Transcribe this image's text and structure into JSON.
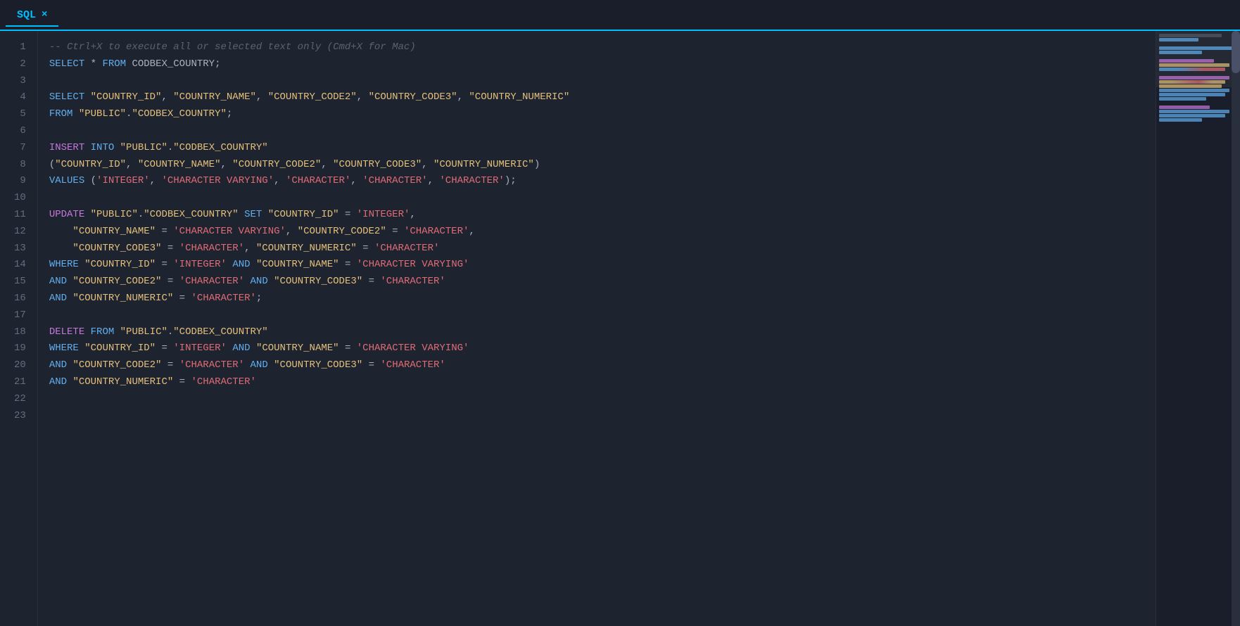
{
  "tab": {
    "label": "SQL",
    "close_icon": "×"
  },
  "line_numbers": [
    1,
    2,
    3,
    4,
    5,
    6,
    7,
    8,
    9,
    10,
    11,
    12,
    13,
    14,
    15,
    16,
    17,
    18,
    19,
    20,
    21,
    22,
    23
  ],
  "lines": [
    {
      "num": 1,
      "content": "comment",
      "text": "-- Ctrl+X to execute all or selected text only (Cmd+X for Mac)"
    },
    {
      "num": 2,
      "content": "select_star",
      "text": "SELECT * FROM CODBEX_COUNTRY;"
    },
    {
      "num": 3,
      "content": "empty",
      "text": ""
    },
    {
      "num": 4,
      "content": "select_cols",
      "text": "SELECT \"COUNTRY_ID\", \"COUNTRY_NAME\", \"COUNTRY_CODE2\", \"COUNTRY_CODE3\", \"COUNTRY_NUMERIC\""
    },
    {
      "num": 5,
      "content": "from_clause",
      "text": "FROM \"PUBLIC\".\"CODBEX_COUNTRY\";"
    },
    {
      "num": 6,
      "content": "empty",
      "text": ""
    },
    {
      "num": 7,
      "content": "insert_into",
      "text": "INSERT INTO \"PUBLIC\".\"CODBEX_COUNTRY\""
    },
    {
      "num": 8,
      "content": "insert_cols",
      "text": "(\"COUNTRY_ID\", \"COUNTRY_NAME\", \"COUNTRY_CODE2\", \"COUNTRY_CODE3\", \"COUNTRY_NUMERIC\")"
    },
    {
      "num": 9,
      "content": "values_clause",
      "text": "VALUES ('INTEGER', 'CHARACTER VARYING', 'CHARACTER', 'CHARACTER', 'CHARACTER');"
    },
    {
      "num": 10,
      "content": "empty",
      "text": ""
    },
    {
      "num": 11,
      "content": "update_set",
      "text": "UPDATE \"PUBLIC\".\"CODBEX_COUNTRY\" SET \"COUNTRY_ID\" = 'INTEGER',"
    },
    {
      "num": 12,
      "content": "update_cols",
      "text": "\"COUNTRY_NAME\" = 'CHARACTER VARYING', \"COUNTRY_CODE2\" = 'CHARACTER',"
    },
    {
      "num": 13,
      "content": "update_cols2",
      "text": "\"COUNTRY_CODE3\" = 'CHARACTER', \"COUNTRY_NUMERIC\" = 'CHARACTER'"
    },
    {
      "num": 14,
      "content": "where_clause",
      "text": "WHERE \"COUNTRY_ID\" = 'INTEGER' AND \"COUNTRY_NAME\" = 'CHARACTER VARYING'"
    },
    {
      "num": 15,
      "content": "and_clause",
      "text": "AND \"COUNTRY_CODE2\" = 'CHARACTER' AND \"COUNTRY_CODE3\" = 'CHARACTER'"
    },
    {
      "num": 16,
      "content": "and_clause2",
      "text": "AND \"COUNTRY_NUMERIC\" = 'CHARACTER';"
    },
    {
      "num": 17,
      "content": "empty",
      "text": ""
    },
    {
      "num": 18,
      "content": "delete_from",
      "text": "DELETE FROM \"PUBLIC\".\"CODBEX_COUNTRY\""
    },
    {
      "num": 19,
      "content": "where_delete",
      "text": "WHERE \"COUNTRY_ID\" = 'INTEGER' AND \"COUNTRY_NAME\" = 'CHARACTER VARYING'"
    },
    {
      "num": 20,
      "content": "and_delete",
      "text": "AND \"COUNTRY_CODE2\" = 'CHARACTER' AND \"COUNTRY_CODE3\" = 'CHARACTER'"
    },
    {
      "num": 21,
      "content": "and_delete2",
      "text": "AND \"COUNTRY_NUMERIC\" = 'CHARACTER'"
    },
    {
      "num": 22,
      "content": "empty",
      "text": ""
    },
    {
      "num": 23,
      "content": "empty",
      "text": ""
    }
  ]
}
